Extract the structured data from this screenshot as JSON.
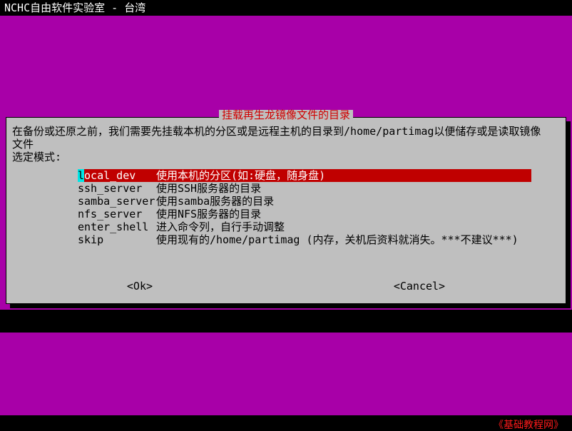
{
  "titlebar": "NCHC自由软件实验室 - 台湾",
  "dialog": {
    "frame_title": "挂载再生龙镜像文件的目录",
    "intro_line1": "在备份或还原之前，我们需要先挂载本机的分区或是远程主机的目录到/home/partimag以便储存或是读取镜像",
    "intro_line2": "文件",
    "intro_line3": "选定模式:",
    "menu": [
      {
        "cmd": "local_dev",
        "desc": "使用本机的分区(如:硬盘，随身盘)",
        "selected": true
      },
      {
        "cmd": "ssh_server",
        "desc": "使用SSH服务器的目录",
        "selected": false
      },
      {
        "cmd": "samba_server",
        "desc": "使用samba服务器的目录",
        "selected": false
      },
      {
        "cmd": "nfs_server",
        "desc": "使用NFS服务器的目录",
        "selected": false
      },
      {
        "cmd": "enter_shell",
        "desc": "进入命令列，自行手动调整",
        "selected": false
      },
      {
        "cmd": "skip",
        "desc": "使用现有的/home/partimag (内存，关机后资料就消失。***不建议***)",
        "selected": false
      }
    ],
    "ok": "<Ok>",
    "cancel": "<Cancel>"
  },
  "watermark": "《基础教程网》"
}
